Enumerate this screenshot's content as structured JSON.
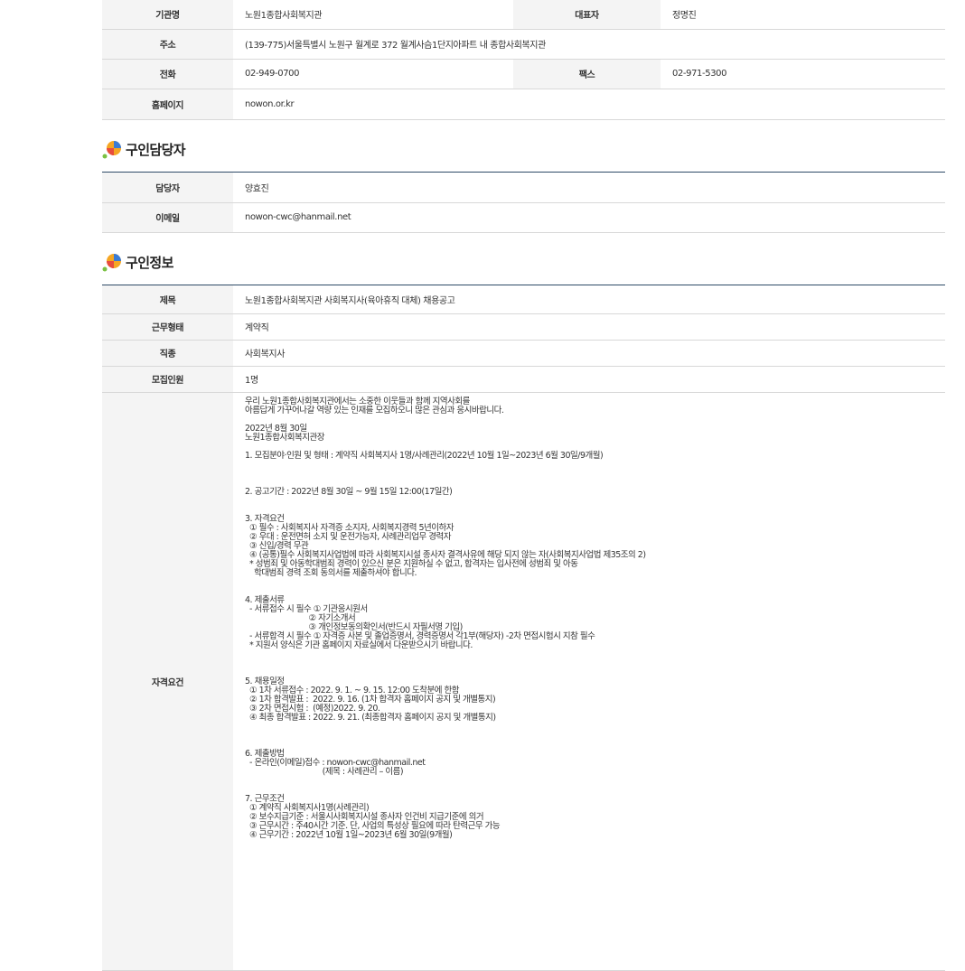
{
  "org": {
    "rows": [
      {
        "label": "기관명",
        "value": "노원1종합사회복지관",
        "label2": "대표자",
        "value2": "정명진"
      },
      {
        "label": "주소",
        "value": "(139-775)서울특별시 노원구 월계로 372 월계사슴1단지아파트 내 종합사회복지관"
      },
      {
        "label": "전화",
        "value": "02-949-0700",
        "label2": "팩스",
        "value2": "02-971-5300"
      },
      {
        "label": "홈페이지",
        "value": "nowon.or.kr"
      }
    ]
  },
  "contact": {
    "title": "구인담당자",
    "rows": [
      {
        "label": "담당자",
        "value": "양효진"
      },
      {
        "label": "이메일",
        "value": "nowon-cwc@hanmail.net"
      }
    ]
  },
  "job": {
    "title": "구인정보",
    "rows": [
      {
        "label": "제목",
        "value": "노원1종합사회복지관 사회복지사(육아휴직 대체) 채용공고"
      },
      {
        "label": "근무형태",
        "value": "계약직"
      },
      {
        "label": "직종",
        "value": "사회복지사"
      },
      {
        "label": "모집인원",
        "value": "1명"
      }
    ],
    "detail_label": "자격요건",
    "detail_lines": [
      "우리 노원1종합사회복지관에서는 소중한 이웃들과 함께 지역사회를",
      "아름답게 가꾸어나갈 역량 있는 인재를 모집하오니 많은 관심과 응시바랍니다.",
      "",
      "2022년 8월 30일",
      "노원1종합사회복지관장",
      "",
      "1. 모집분야·인원 및 형태 : 계약직 사회복지사 1명/사례관리(2022년 10월 1일~2023년 6월 30일/9개월)",
      "",
      "",
      "",
      "2. 공고기간 : 2022년 8월 30일 ~ 9월 15일 12:00(17일간)",
      "",
      "",
      "3. 자격요건",
      "  ① 필수 : 사회복지사 자격증 소지자, 사회복지경력 5년이하자",
      "  ② 우대 : 운전면허 소지 및 운전가능자, 사례관리업무 경력자",
      "  ③ 신입/경력 무관",
      "  ④ (공통)필수 사회복지사업법에 따라 사회복지시설 종사자 결격사유에 해당 되지 않는 자(사회복지사업법 제35조의 2)",
      "  * 성범죄 및 아동학대범죄 경력이 있으신 분은 지원하실 수 없고, 합격자는 입사전에 성범죄 및 아동",
      "    학대범죄 경력 조회 동의서를 제출하셔야 합니다.",
      "",
      "",
      "4. 제출서류",
      "  - 서류접수 시 필수 ① 기관응시원서",
      "                            ② 자기소개서",
      "                            ③ 개인정보동의확인서(반드시 자필서명 기입)",
      "  - 서류합격 시 필수 ① 자격증 사본 및 졸업증명서, 경력증명서 각1부(해당자) -2차 면접시험시 지참 필수",
      "  * 지원서 양식은 기관 홈페이지 자료실에서 다운받으시기 바랍니다.",
      "",
      "",
      "",
      "5. 채용일정",
      "  ① 1차 서류접수 : 2022. 9. 1. ~ 9. 15. 12:00 도착분에 한함",
      "  ② 1차 합격발표 :  2022. 9. 16. (1차 합격자 홈페이지 공지 및 개별통지)",
      "  ③ 2차 면접시험 :  (예정)2022. 9. 20.",
      "  ④ 최종 합격발표 : 2022. 9. 21. (최종합격자 홈페이지 공지 및 개별통지)",
      "",
      "",
      "",
      "6. 제출방법",
      "  - 온라인(이메일)접수 : nowon-cwc@hanmail.net",
      "                                  (제목 : 사례관리 – 이름)",
      "",
      "",
      "7. 근무조건",
      "  ① 계약직 사회복지사1명(사례관리)",
      "  ② 보수지급기준 : 서울시사회복지시설 종사자 인건비 지급기준에 의거",
      "  ③ 근무시간 : 주40시간 기준. 단, 사업의 특성상 필요에 따라 탄력근무 가능",
      "  ④ 근무기간 : 2022년 10월 1일~2023년 6월 30일(9개월)"
    ]
  },
  "colors": {
    "header_line": "#2e4a66",
    "th_bg": "#f4f4f4",
    "border": "#d8d8d8"
  },
  "icons": [
    "section-bullet-icon"
  ]
}
